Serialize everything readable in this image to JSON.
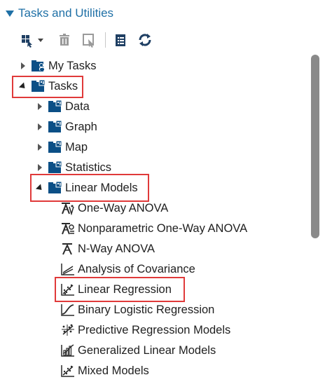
{
  "panel": {
    "title": "Tasks and Utilities"
  },
  "toolbar": {
    "buttons": [
      {
        "name": "new-task-dropdown",
        "icon": "tasks-dropdown-icon"
      },
      {
        "name": "delete",
        "icon": "trash-icon"
      },
      {
        "name": "properties",
        "icon": "edit-pointer-icon"
      },
      {
        "name": "list",
        "icon": "list-icon"
      },
      {
        "name": "refresh",
        "icon": "refresh-icon"
      }
    ]
  },
  "tree": {
    "items": [
      {
        "label": "My Tasks",
        "level": 1,
        "state": "collapsed",
        "icon": "folder-user-icon"
      },
      {
        "label": "Tasks",
        "level": 1,
        "state": "expanded",
        "icon": "folder-tasks-icon",
        "highlighted": true
      },
      {
        "label": "Data",
        "level": 2,
        "state": "collapsed",
        "icon": "folder-tasks-icon"
      },
      {
        "label": "Graph",
        "level": 2,
        "state": "collapsed",
        "icon": "folder-tasks-icon"
      },
      {
        "label": "Map",
        "level": 2,
        "state": "collapsed",
        "icon": "folder-tasks-icon"
      },
      {
        "label": "Statistics",
        "level": 2,
        "state": "collapsed",
        "icon": "folder-tasks-icon"
      },
      {
        "label": "Linear Models",
        "level": 2,
        "state": "expanded",
        "icon": "folder-tasks-icon",
        "highlighted": true
      },
      {
        "label": "One-Way ANOVA",
        "level": 3,
        "icon": "anova-icon"
      },
      {
        "label": "Nonparametric One-Way ANOVA",
        "level": 3,
        "icon": "nonparametric-anova-icon"
      },
      {
        "label": "N-Way ANOVA",
        "level": 3,
        "icon": "nway-anova-icon"
      },
      {
        "label": "Analysis of Covariance",
        "level": 3,
        "icon": "covariance-icon"
      },
      {
        "label": "Linear Regression",
        "level": 3,
        "icon": "scatter-regression-icon",
        "highlighted": true
      },
      {
        "label": "Binary Logistic Regression",
        "level": 3,
        "icon": "logistic-curve-icon"
      },
      {
        "label": "Predictive Regression Models",
        "level": 3,
        "icon": "scatter-regression-icon"
      },
      {
        "label": "Generalized Linear Models",
        "level": 3,
        "icon": "glm-icon"
      },
      {
        "label": "Mixed Models",
        "level": 3,
        "icon": "scatter-regression-icon"
      }
    ]
  },
  "colors": {
    "accent": "#1f70a6",
    "highlight": "#e03a3a",
    "folder": "#0b4f86",
    "icon": "#2a2a2a"
  }
}
